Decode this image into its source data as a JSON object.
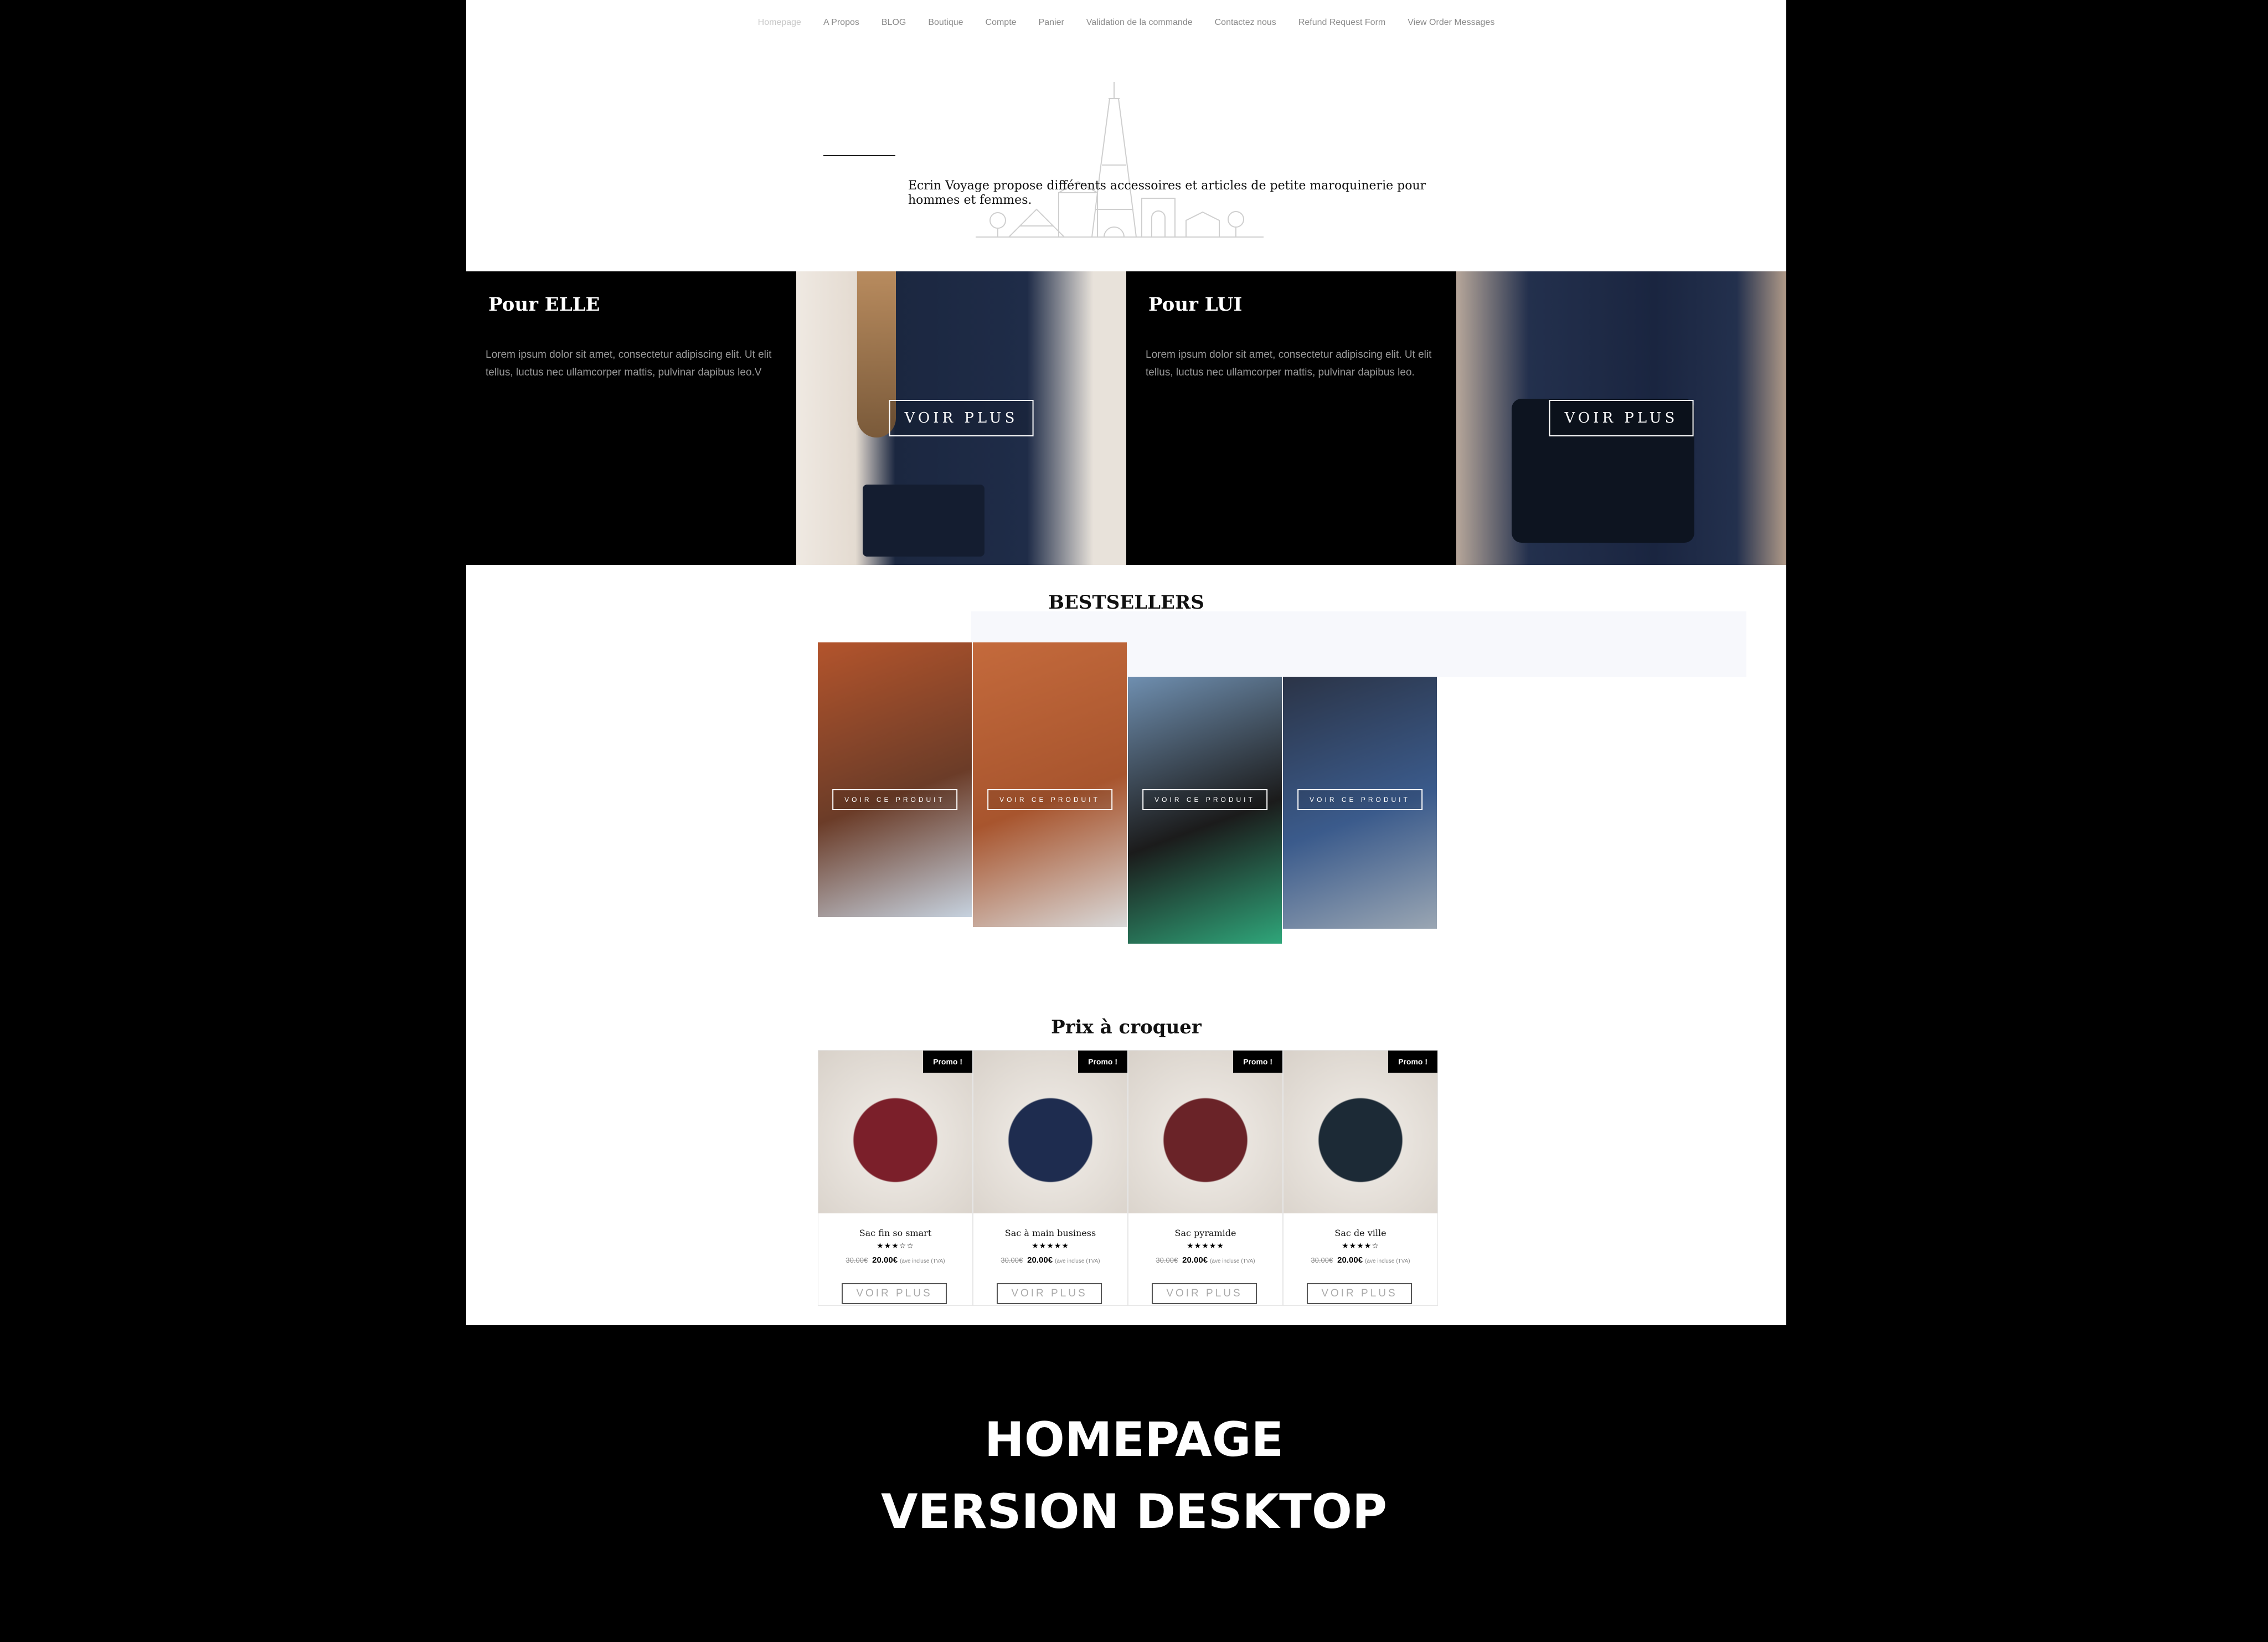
{
  "nav": {
    "items": [
      "Homepage",
      "A Propos",
      "BLOG",
      "Boutique",
      "Compte",
      "Panier",
      "Validation de la commande",
      "Contactez nous",
      "Refund Request Form",
      "View Order Messages"
    ]
  },
  "hero": {
    "text": "Ecrin Voyage propose différents accessoires et articles de petite maroquinerie pour hommes et femmes."
  },
  "categories": {
    "elle": {
      "title": "Pour ELLE",
      "desc": "Lorem ipsum dolor sit amet, consectetur adipiscing elit. Ut elit tellus, luctus nec ullamcorper mattis, pulvinar dapibus leo.V",
      "button": "VOIR PLUS"
    },
    "lui": {
      "title": "Pour LUI",
      "desc": "Lorem ipsum dolor sit amet, consectetur adipiscing elit. Ut elit tellus, luctus nec ullamcorper mattis, pulvinar dapibus leo.",
      "button": "VOIR PLUS"
    }
  },
  "bestsellers": {
    "title": "BESTSELLERS",
    "button_label": "VOIR CE PRODUIT",
    "cards": [
      {
        "colors": [
          "#b3542c",
          "#6b3c28",
          "#c6d2df"
        ]
      },
      {
        "colors": [
          "#c46a3c",
          "#a8552e",
          "#d9d9d9"
        ]
      },
      {
        "colors": [
          "#6f8fb0",
          "#1b1b1b",
          "#2fa67a"
        ]
      },
      {
        "colors": [
          "#2b3447",
          "#3b5b8c",
          "#9aa6b3"
        ]
      }
    ]
  },
  "promo": {
    "title": "Prix à croquer",
    "badge": "Promo !",
    "button": "VOIR PLUS",
    "price_note": "(ave incluse (TVA)",
    "products": [
      {
        "name": "Sac fin so smart",
        "stars": "★★★☆☆",
        "old_price": "30.00€",
        "price": "20.00€",
        "color": "#7b1f2a"
      },
      {
        "name": "Sac à main business",
        "stars": "★★★★★",
        "old_price": "30.00€",
        "price": "20.00€",
        "color": "#1e2c4f"
      },
      {
        "name": "Sac pyramide",
        "stars": "★★★★★",
        "old_price": "30.00€",
        "price": "20.00€",
        "color": "#6a2328"
      },
      {
        "name": "Sac de ville",
        "stars": "★★★★☆",
        "old_price": "30.00€",
        "price": "20.00€",
        "color": "#1c2a36"
      }
    ]
  },
  "caption": {
    "line1": "HOMEPAGE",
    "line2": "VERSION DESKTOP"
  }
}
